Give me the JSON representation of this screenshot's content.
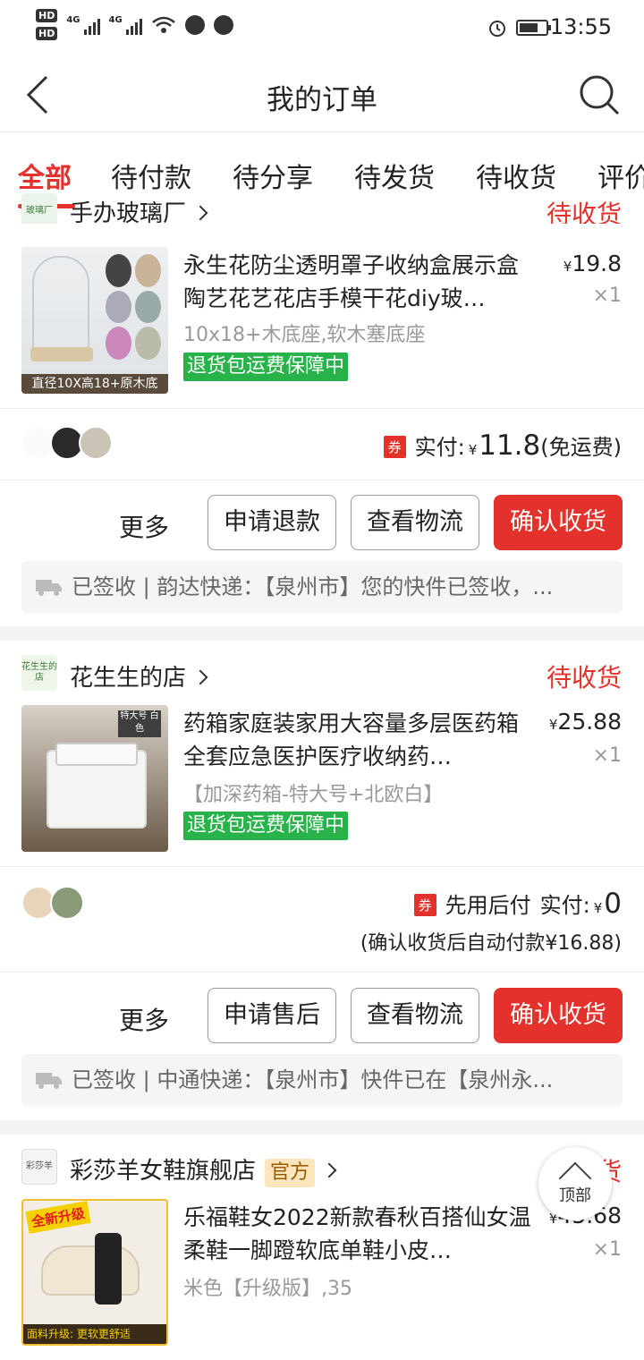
{
  "status_bar": {
    "time": "13:55",
    "hd1": "HD",
    "hd2": "HD",
    "net1": "4G",
    "net2": "4G"
  },
  "nav": {
    "title": "我的订单"
  },
  "tabs": [
    {
      "label": "全部"
    },
    {
      "label": "待付款"
    },
    {
      "label": "待分享"
    },
    {
      "label": "待发货"
    },
    {
      "label": "待收货"
    },
    {
      "label": "评价"
    }
  ],
  "orders": [
    {
      "shop_logo": "玻璃厂",
      "shop_name": "手办玻璃厂",
      "status": "待收货",
      "product_title": "永生花防尘透明罩子收纳盒展示盒陶艺花艺花店手模干花diy玻…",
      "price": "19.8",
      "qty": "×1",
      "spec": "10x18+木底座,软木塞底座",
      "guarantee": "退货包运费保障中",
      "thumb_caption": "直径10X高18+原木底",
      "coupon": "券",
      "pay_label": "实付:",
      "pay_amount": "11.8",
      "pay_note": "(免运费)",
      "more": "更多",
      "buttons": [
        "申请退款",
        "查看物流",
        "确认收货"
      ],
      "logistics": "已签收 | 韵达快递：【泉州市】您的快件已签收，..."
    },
    {
      "shop_logo": "花生生的店",
      "shop_name": "花生生的店",
      "status": "待收货",
      "product_title": "药箱家庭装家用大容量多层医药箱全套应急医护医疗收纳药…",
      "price": "25.88",
      "qty": "×1",
      "spec": "【加深药箱-特大号+北欧白】",
      "guarantee": "退货包运费保障中",
      "thumb_caption": "特大号 白色",
      "coupon": "券",
      "pay_prefix": "先用后付",
      "pay_label": "实付:",
      "pay_amount": "0",
      "sub_note": "(确认收货后自动付款¥16.88)",
      "more": "更多",
      "buttons": [
        "申请售后",
        "查看物流",
        "确认收货"
      ],
      "logistics": "已签收 | 中通快递：【泉州市】快件已在【泉州永..."
    },
    {
      "shop_logo": "彩莎羊",
      "shop_name": "彩莎羊女鞋旗舰店",
      "official_tag": "官方",
      "status": "待收货",
      "product_title": "乐福鞋女2022新款春秋百搭仙女温柔鞋一脚蹬软底单鞋小皮…",
      "price": "45.68",
      "qty": "×1",
      "spec": "米色【升级版】,35",
      "thumb_badge": "全新升级",
      "thumb_caption": "面料升级: 更软更舒适"
    }
  ],
  "to_top": "顶部",
  "yen": "¥",
  "colors": {
    "accent": "#e5312b",
    "guarantee": "#27b24a"
  }
}
